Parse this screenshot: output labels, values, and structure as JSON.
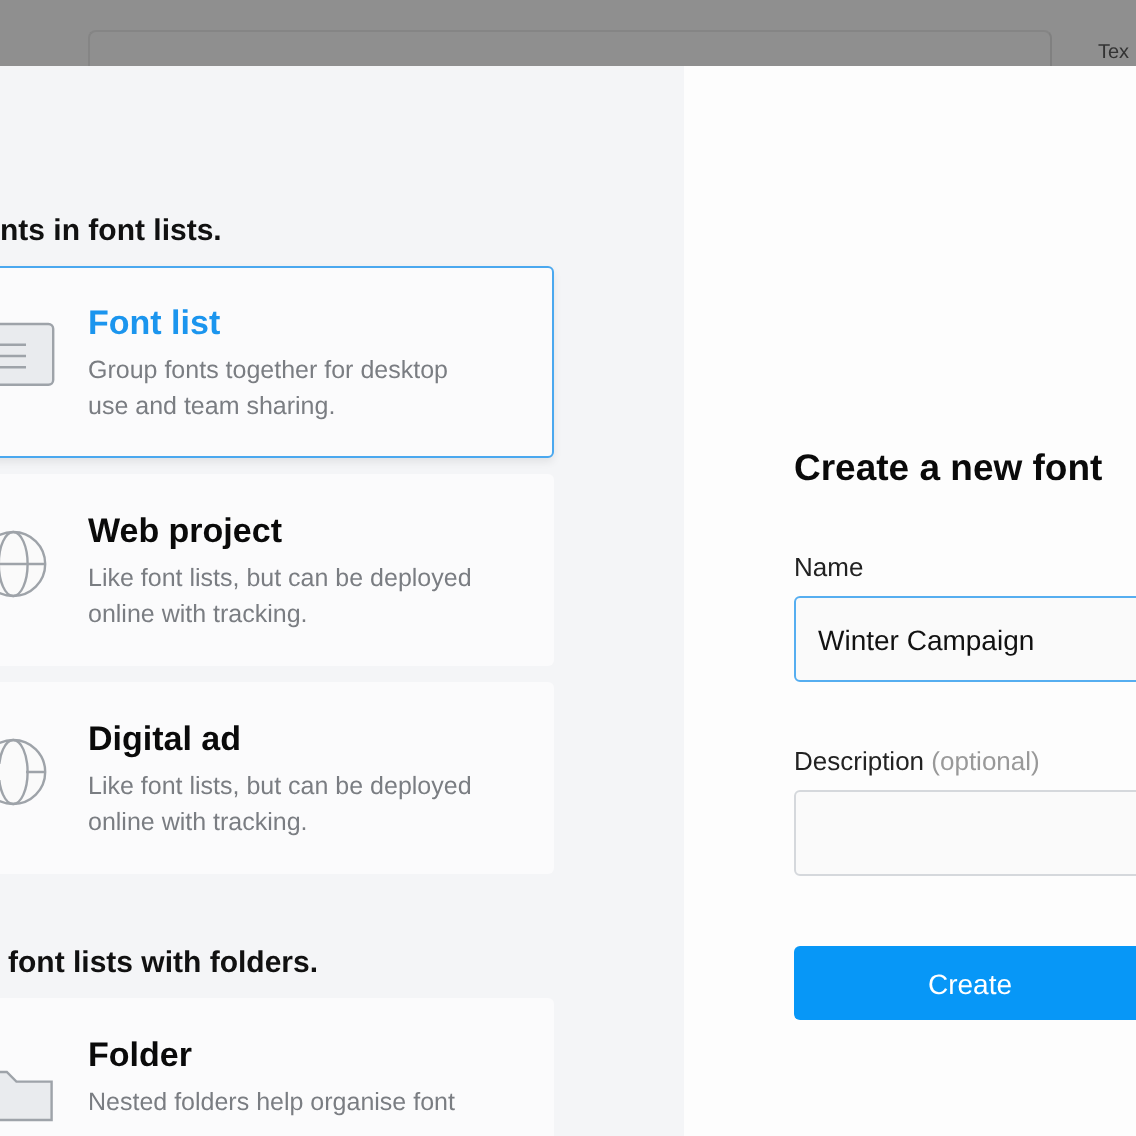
{
  "background": {
    "label": "Tex"
  },
  "sections": [
    {
      "heading": "nts in font lists.",
      "cards": [
        {
          "kind": "list",
          "title": "Font list",
          "description": "Group fonts together for desktop use and team sharing.",
          "selected": true
        },
        {
          "kind": "globe",
          "title": "Web project",
          "description": "Like font lists, but can be deployed online with tracking.",
          "selected": false
        },
        {
          "kind": "ad",
          "title": "Digital ad",
          "description": "Like font lists, but can be deployed online with tracking.",
          "selected": false
        }
      ]
    },
    {
      "heading": "font lists with folders.",
      "cards": [
        {
          "kind": "folder",
          "title": "Folder",
          "description": "Nested folders help organise font",
          "selected": false
        }
      ]
    }
  ],
  "form": {
    "title": "Create a new font",
    "name_label": "Name",
    "name_value": "Winter Campaign",
    "description_label": "Description",
    "description_hint": "(optional)",
    "button": "Create"
  }
}
